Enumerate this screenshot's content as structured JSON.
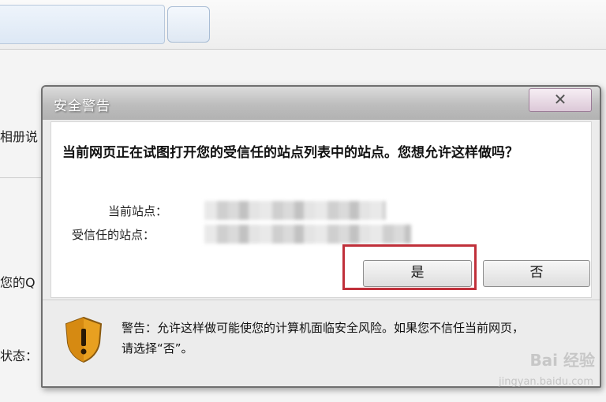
{
  "background": {
    "labels": [
      "相册说",
      "您的Q",
      "状态："
    ]
  },
  "dialog": {
    "title": "安全警告",
    "close_icon": "✕",
    "message": "当前网页正在试图打开您的受信任的站点列表中的站点。您想允许这样做吗？",
    "current_site_label": "当前站点：",
    "trusted_site_label": "受信任的站点：",
    "yes_label": "是",
    "no_label": "否",
    "warning_icon": "shield-warning-icon",
    "warning_text": "警告：允许这样做可能使您的计算机面临安全风险。如果您不信任当前网页，请选择“否”。"
  },
  "watermark": {
    "brand": "Bai 经验",
    "url": "jingyan.baidu.com"
  },
  "colors": {
    "highlight": "#c0303a",
    "shield": "#e8a020"
  }
}
